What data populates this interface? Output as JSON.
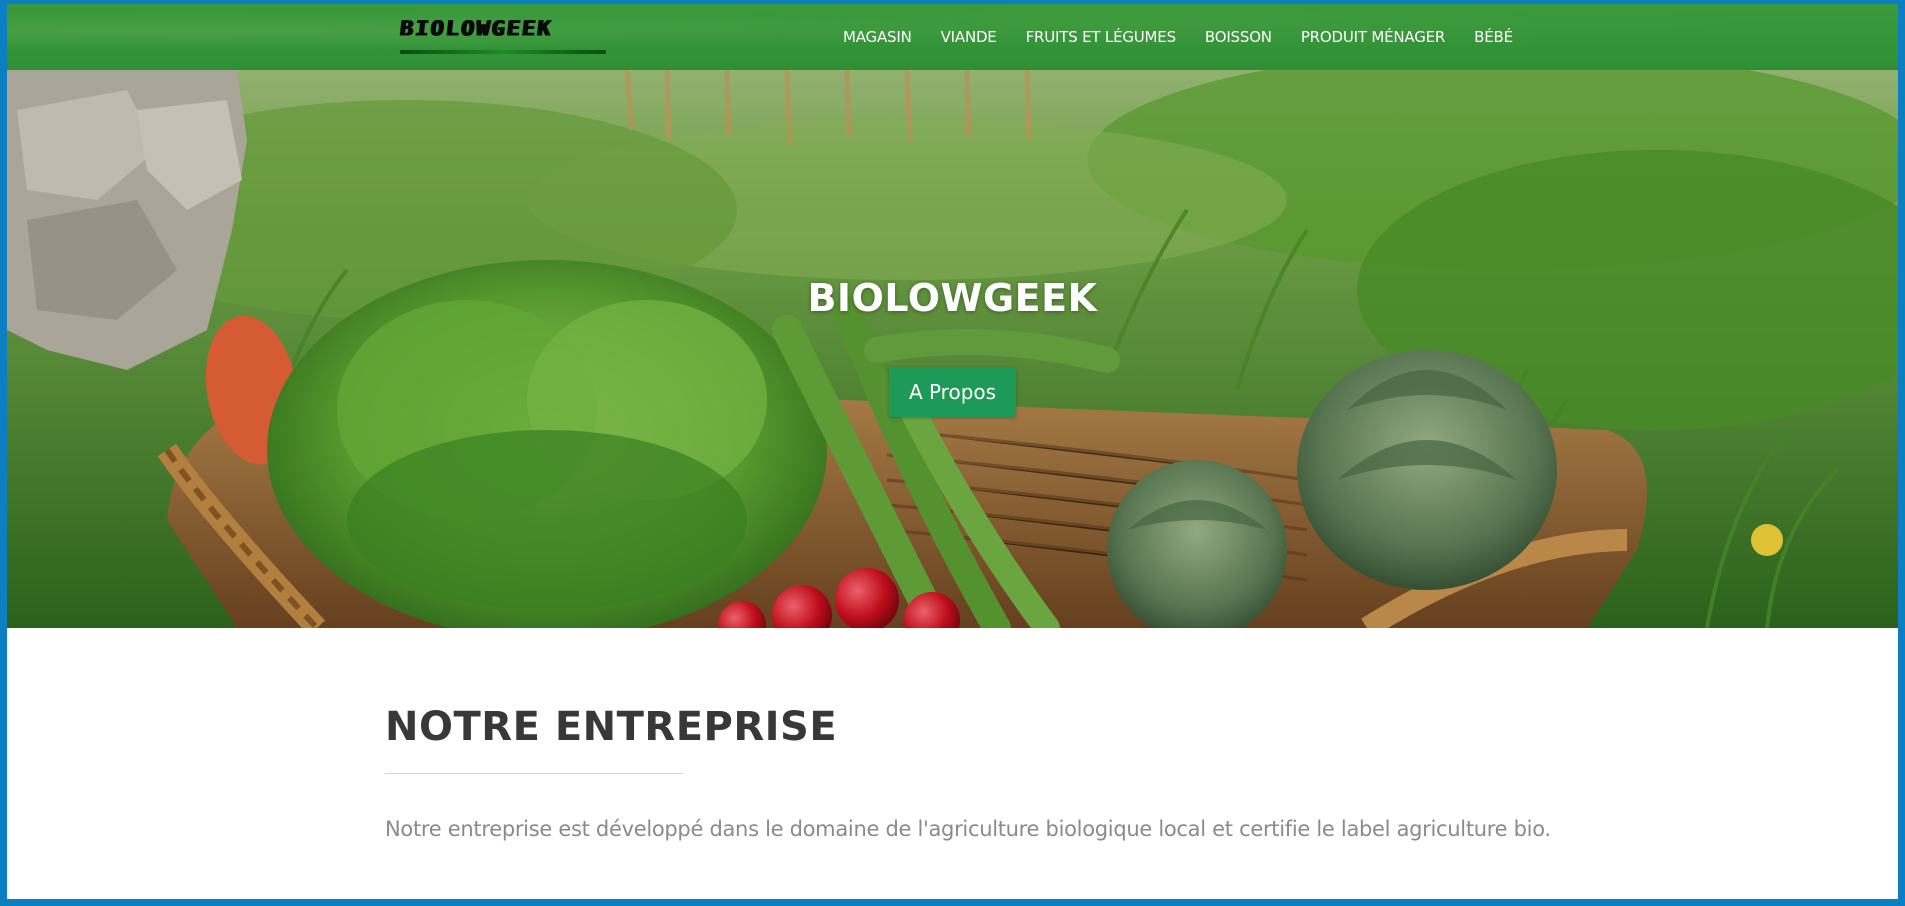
{
  "navbar": {
    "brand": "BIOLOWGEEK",
    "items": [
      {
        "label": "MAGASIN"
      },
      {
        "label": "VIANDE"
      },
      {
        "label": "FRUITS ET LÉGUMES"
      },
      {
        "label": "BOISSON"
      },
      {
        "label": "PRODUIT MÉNAGER"
      },
      {
        "label": "BÉBÉ"
      }
    ]
  },
  "hero": {
    "title": "BIOLOWGEEK",
    "button_label": "A Propos"
  },
  "about": {
    "title": "NOTRE ENTREPRISE",
    "text": "Notre entreprise est développé dans le domaine de l'agriculture biologique local et certifie le label agriculture bio."
  },
  "colors": {
    "frame_border": "#0b7fc2",
    "navbar_green": "#2f8f35",
    "button_green": "#1d9a57",
    "heading_text": "#383838",
    "body_text": "#8a8a8a"
  }
}
